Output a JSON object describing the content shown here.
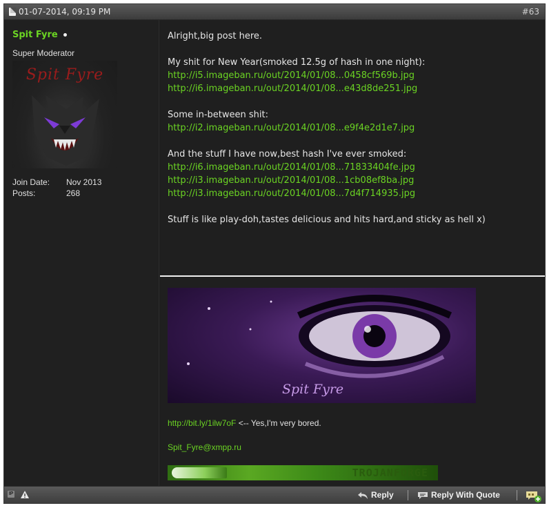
{
  "header": {
    "date": "01-07-2014, 09:19 PM",
    "post_number": "#63"
  },
  "user": {
    "name": "Spit Fyre",
    "title": "Super Moderator",
    "avatar_text": "Spit Fyre",
    "join_date_label": "Join Date:",
    "join_date": "Nov 2013",
    "posts_label": "Posts:",
    "posts": "268"
  },
  "content": {
    "intro": "Alright,big post here.",
    "new_year_text": "My shit for New Year(smoked 12.5g of hash in one night):",
    "new_year_links": [
      "http://i5.imageban.ru/out/2014/01/08...0458cf569b.jpg",
      "http://i6.imageban.ru/out/2014/01/08...e43d8de251.jpg"
    ],
    "between_text": "Some in-between shit:",
    "between_links": [
      "http://i2.imageban.ru/out/2014/01/08...e9f4e2d1e7.jpg"
    ],
    "now_text": "And the stuff I have now,best hash I've ever smoked:",
    "now_links": [
      "http://i6.imageban.ru/out/2014/01/08...71833404fe.jpg",
      "http://i3.imageban.ru/out/2014/01/08...1cb08ef8ba.jpg",
      "http://i3.imageban.ru/out/2014/01/08...7d4f714935.jpg"
    ],
    "closing": "Stuff is like play-doh,tastes delicious and hits hard,and sticky as hell x)"
  },
  "signature": {
    "banner_text": "Spit Fyre",
    "link": "http://bit.ly/1ilw7oF",
    "link_suffix": " <-- Yes,I'm very bored.",
    "email": "Spit_Fyre@xmpp.ru",
    "forge_banner_text": "TROJANFORGE"
  },
  "footer": {
    "ip_icon": "IP",
    "reply_label": "Reply",
    "reply_quote_label": "Reply With Quote"
  }
}
